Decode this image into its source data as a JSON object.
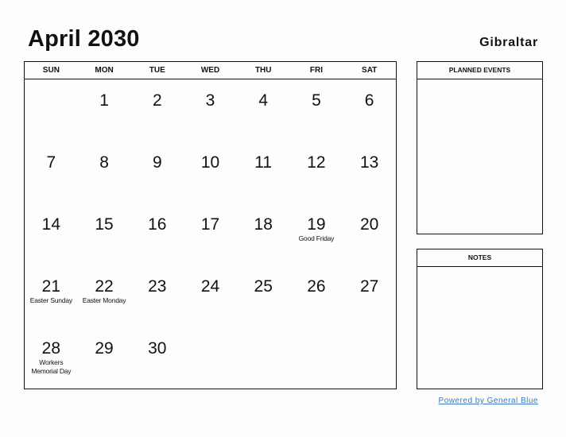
{
  "header": {
    "title": "April 2030",
    "country": "Gibraltar"
  },
  "weekdays": [
    "SUN",
    "MON",
    "TUE",
    "WED",
    "THU",
    "FRI",
    "SAT"
  ],
  "weeks": [
    [
      {
        "d": "",
        "h": ""
      },
      {
        "d": "1",
        "h": ""
      },
      {
        "d": "2",
        "h": ""
      },
      {
        "d": "3",
        "h": ""
      },
      {
        "d": "4",
        "h": ""
      },
      {
        "d": "5",
        "h": ""
      },
      {
        "d": "6",
        "h": ""
      }
    ],
    [
      {
        "d": "7",
        "h": ""
      },
      {
        "d": "8",
        "h": ""
      },
      {
        "d": "9",
        "h": ""
      },
      {
        "d": "10",
        "h": ""
      },
      {
        "d": "11",
        "h": ""
      },
      {
        "d": "12",
        "h": ""
      },
      {
        "d": "13",
        "h": ""
      }
    ],
    [
      {
        "d": "14",
        "h": ""
      },
      {
        "d": "15",
        "h": ""
      },
      {
        "d": "16",
        "h": ""
      },
      {
        "d": "17",
        "h": ""
      },
      {
        "d": "18",
        "h": ""
      },
      {
        "d": "19",
        "h": "Good Friday"
      },
      {
        "d": "20",
        "h": ""
      }
    ],
    [
      {
        "d": "21",
        "h": "Easter Sunday"
      },
      {
        "d": "22",
        "h": "Easter Monday"
      },
      {
        "d": "23",
        "h": ""
      },
      {
        "d": "24",
        "h": ""
      },
      {
        "d": "25",
        "h": ""
      },
      {
        "d": "26",
        "h": ""
      },
      {
        "d": "27",
        "h": ""
      }
    ],
    [
      {
        "d": "28",
        "h": "Workers Memorial Day"
      },
      {
        "d": "29",
        "h": ""
      },
      {
        "d": "30",
        "h": ""
      },
      {
        "d": "",
        "h": ""
      },
      {
        "d": "",
        "h": ""
      },
      {
        "d": "",
        "h": ""
      },
      {
        "d": "",
        "h": ""
      }
    ]
  ],
  "sidebar": {
    "planned_events": "PLANNED EVENTS",
    "notes": "NOTES"
  },
  "footer": {
    "powered_by": "Powered by General Blue",
    "link_color": "#3a78c2"
  }
}
